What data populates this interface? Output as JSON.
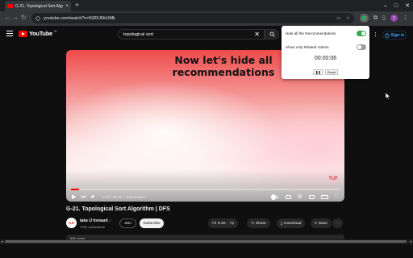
{
  "browser": {
    "tab_title": "G-21. Topological Sort Algorith...",
    "tab_close": "×",
    "new_tab": "+",
    "minimize": "–",
    "maximize": "□",
    "close": "✕",
    "url": "youtube.com/watch?v=5lZ0iJMrUMk",
    "extension_badge": "2"
  },
  "youtube": {
    "logo_text": "YouTube",
    "country_code": "IN",
    "search_value": "topological sort",
    "search_clear": "✕",
    "sign_in": "Sign in"
  },
  "video": {
    "overlay_text": "Now let's hide all recommendations",
    "watermark": "TUF",
    "progress": 0.03,
    "time": "0:02 / 13:29",
    "chapter": "• Introduction ›",
    "title": "G-21. Topological Sort Algorithm | DFS"
  },
  "channel": {
    "avatar_text": "TUF",
    "name": "take U forward",
    "verified": "✓",
    "subscribers": "799K subscribers",
    "join": "Join",
    "subscribe": "Subscribe"
  },
  "actions": {
    "likes": "9.4K",
    "share": "Share",
    "download": "Download",
    "save": "Save",
    "more": "···"
  },
  "description": {
    "stats": "65K views"
  },
  "popup": {
    "hide_all_label": "Hide all the Recommendations",
    "hide_all_on": true,
    "related_only_label": "Show only Related Videos",
    "related_only_on": false,
    "timer": "00:00:06",
    "pause_symbol": "❚❚",
    "reset": "Reset"
  },
  "colors": {
    "accent_red": "#ff0000",
    "toggle_on": "#34a853",
    "link_blue": "#3ea6ff"
  }
}
